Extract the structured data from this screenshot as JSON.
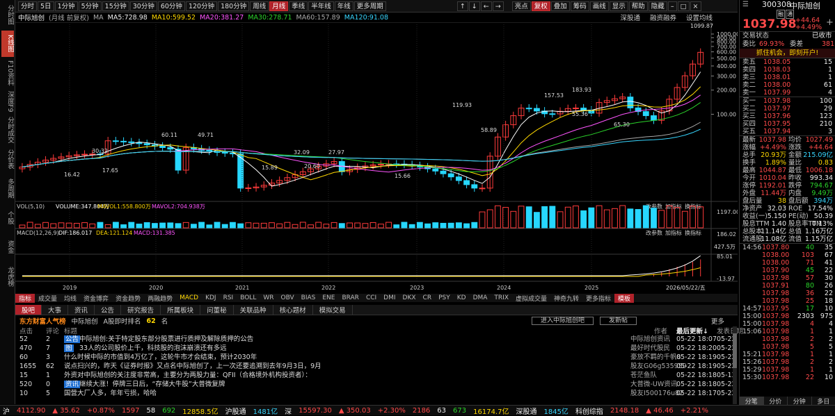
{
  "left_tabs": [
    "分时图",
    "K线图",
    "F10资料",
    "深度F9",
    "分时成交",
    "分价表",
    "多周期",
    "个股",
    "资金",
    "龙虎榜"
  ],
  "left_active": 1,
  "toolbar": {
    "periods": [
      "分时",
      "5日",
      "1分钟",
      "5分钟",
      "15分钟",
      "30分钟",
      "60分钟",
      "120分钟",
      "180分钟",
      "周线",
      "月线",
      "季线",
      "半年线",
      "年线",
      "更多周期"
    ],
    "active_period": "月线",
    "nav_arrows": [
      "↑",
      "↓",
      "←",
      "→"
    ],
    "right_items": [
      "亮点",
      "复权",
      "叠加",
      "筹码",
      "画线",
      "显示",
      "帮助",
      "隐藏"
    ],
    "active_right": "复权"
  },
  "info": {
    "stock_name": "中际旭创",
    "mode": "(月线 前复权)",
    "ma_label": "MA",
    "ma5": "MA5:728.98",
    "ma10": "MA10:599.52",
    "ma20": "MA20:381.27",
    "ma30": "MA30:278.71",
    "ma60": "MA60:157.89",
    "ma120": "MA120:91.08",
    "links": [
      "深股通",
      "融资融券",
      "设置均线"
    ]
  },
  "chart": {
    "y_ticks": [
      "1000.00",
      "900.00",
      "800.00",
      "700.00",
      "600.00",
      "500.00",
      "400.00",
      "300.00",
      "200.00",
      "100.00"
    ],
    "price_annotations": [
      "1099.87",
      "183.93",
      "157.53",
      "119.93",
      "60.11",
      "49.71",
      "32.09",
      "30.32",
      "27.97",
      "20.60",
      "17.65",
      "16.42",
      "15.89",
      "15.66",
      "58.89",
      "55.36",
      "65.30"
    ],
    "x_years": [
      "2019",
      "2020",
      "2021",
      "2022",
      "2023",
      "2024",
      "2025"
    ],
    "x_date": "2026/05/22/五",
    "vol_label": "VOL(5,10)",
    "vol_value": "VOLUME:347.804万",
    "vol_ma1": "MAVOL1:558.800万",
    "vol_ma2": "MAVOL2:704.938万",
    "vol_ticks": [
      "1197.00",
      "427.5万"
    ],
    "vol_links": [
      "改参数",
      "加指标",
      "换指标"
    ],
    "macd_label": "MACD(12,26,9)",
    "dif": "DIF:186.017",
    "dea": "DEA:121.124",
    "macd": "MACD:131.385",
    "macd_ticks": [
      "186.02",
      "85.01",
      "-13.97"
    ]
  },
  "indicator_tabs": [
    "指标",
    "成交量",
    "均线",
    "资金博弈",
    "资金趋势",
    "两融趋势",
    "MACD",
    "KDJ",
    "RSI",
    "BOLL",
    "WR",
    "OBV",
    "BIAS",
    "ENE",
    "BRAR",
    "CCI",
    "DMI",
    "DKX",
    "CR",
    "PSY",
    "KD",
    "DMA",
    "TRIX",
    "虚拟成交量",
    "神奇九转",
    "更多指标",
    "模板"
  ],
  "news_tabs": [
    "股吧",
    "大事",
    "资讯",
    "公告",
    "研究报告",
    "所属板块",
    "问董秘",
    "关联品种",
    "核心题材",
    "模拟交易"
  ],
  "news": {
    "brand": "东方财富人气榜",
    "stock": "中际旭创",
    "rank_label": "A股即时排名",
    "rank": "62",
    "rank_unit": "名",
    "enter_btn": "进入中际旭创吧",
    "post_btn": "发新帖",
    "more": "更多",
    "headers": [
      "点击",
      "评论",
      "标题",
      "作者",
      "最后更新",
      "发表日期"
    ],
    "rows": [
      {
        "clicks": "52",
        "comments": "2",
        "tag": "公告",
        "title": "中际旭创:关于特定股东部分股票进行质押及解除质押的公告",
        "author": "中际旭创资讯",
        "updated": "05-22 18:07",
        "date": "05-22"
      },
      {
        "clicks": "470",
        "comments": "7",
        "tag": "图",
        "title": "33人的公司股价上千，科技股的泡沫崩溃还有多远",
        "author": "最好时代股民",
        "updated": "05-22 18:20",
        "date": "05-22"
      },
      {
        "clicks": "60",
        "comments": "3",
        "tag": "",
        "title": "什么时候中际的市值到4万亿了，这轮牛市才会结束，预计2030年",
        "author": "豪放不羁的千帆8",
        "updated": "05-22 18:19",
        "date": "05-22"
      },
      {
        "clicks": "1655",
        "comments": "62",
        "tag": "",
        "title": "说点扫兴的，昨天《证券时报》又点名中际旭创了，上一次还要追溯到去年9月3日，9月",
        "author": "股友G06g535959",
        "updated": "05-22 18:19",
        "date": "05-22"
      },
      {
        "clicks": "15",
        "comments": "1",
        "tag": "",
        "title": "外资对中际旭创的关注度非常高，主要分为两股力量：QFII（合格境外机构投资者）：",
        "author": "苍茫鱼队",
        "updated": "05-22 18:18",
        "date": "05-13"
      },
      {
        "clicks": "520",
        "comments": "0",
        "tag": "资讯",
        "title": "继续大涨！停牌三日后，“存储大牛股”大普微复牌",
        "author": "大普微-UW资讯",
        "updated": "05-22 18:18",
        "date": "05-22"
      },
      {
        "clicks": "10",
        "comments": "5",
        "tag": "",
        "title": "国营大厂人多，年年亏损，哈哈",
        "author": "股友I500176u82",
        "updated": "05-22 18:17",
        "date": "05-22"
      }
    ]
  },
  "quote": {
    "code": "300308",
    "name": "中际旭创",
    "badges": [
      "融",
      "通"
    ],
    "price": "1037.98",
    "change": "+44.64",
    "pct": "+4.49%",
    "status_label": "交易状态",
    "status": "已收市",
    "weibi_label": "委比",
    "weibi": "69.93%",
    "weicha_label": "委差",
    "weicha": "381",
    "ad": "抓住机会，即刻开户!",
    "sells": [
      {
        "label": "卖五",
        "price": "1038.05",
        "vol": "15"
      },
      {
        "label": "卖四",
        "price": "1038.03",
        "vol": "1"
      },
      {
        "label": "卖三",
        "price": "1038.01",
        "vol": "1"
      },
      {
        "label": "卖二",
        "price": "1038.00",
        "vol": "61"
      },
      {
        "label": "卖一",
        "price": "1037.99",
        "vol": "4"
      }
    ],
    "buys": [
      {
        "label": "买一",
        "price": "1037.98",
        "vol": "100"
      },
      {
        "label": "买二",
        "price": "1037.97",
        "vol": "29"
      },
      {
        "label": "买三",
        "price": "1037.96",
        "vol": "123"
      },
      {
        "label": "买四",
        "price": "1037.95",
        "vol": "210"
      },
      {
        "label": "买五",
        "price": "1037.94",
        "vol": "3"
      }
    ],
    "stats": [
      {
        "l1": "最新",
        "v1": "1037.98",
        "c1": "red",
        "l2": "均价",
        "v2": "1027.49",
        "c2": "red"
      },
      {
        "l1": "涨幅",
        "v1": "+4.49%",
        "c1": "red",
        "l2": "涨跌",
        "v2": "+44.64",
        "c2": "red"
      },
      {
        "l1": "总手",
        "v1": "20.93万",
        "c1": "yel",
        "l2": "金额",
        "v2": "215.09亿",
        "c2": "cyan"
      },
      {
        "l1": "换手",
        "v1": "1.89%",
        "c1": "yel",
        "l2": "量比",
        "v2": "0.83",
        "c2": "yel"
      },
      {
        "l1": "最高",
        "v1": "1044.87",
        "c1": "red",
        "l2": "最低",
        "v2": "1006.18",
        "c2": "red"
      },
      {
        "l1": "今开",
        "v1": "1010.04",
        "c1": "red",
        "l2": "昨收",
        "v2": "993.34",
        "c2": "wht"
      },
      {
        "l1": "涨停",
        "v1": "1192.01",
        "c1": "red",
        "l2": "跌停",
        "v2": "794.67",
        "c2": "grn"
      },
      {
        "l1": "外盘",
        "v1": "11.44万",
        "c1": "red",
        "l2": "内盘",
        "v2": "9.49万",
        "c2": "grn"
      },
      {
        "l1": "盘后量",
        "v1": "38",
        "c1": "yel",
        "l2": "盘后额",
        "v2": "394万",
        "c2": "cyan"
      },
      {
        "l1": "净资产",
        "v1": "32.03",
        "c1": "wht",
        "l2": "ROE",
        "v2": "17.54%",
        "c2": "wht"
      },
      {
        "l1": "收益(一)",
        "v1": "5.150",
        "c1": "wht",
        "l2": "PE(动)",
        "v2": "50.39",
        "c2": "wht"
      },
      {
        "l1": "股息TTM",
        "v1": "1.40",
        "c1": "wht",
        "l2": "股息率TTM",
        "v2": "0.13%",
        "c2": "wht"
      },
      {
        "l1": "总股本",
        "v1": "11.14亿",
        "c1": "wht",
        "l2": "总值",
        "v2": "1.16万亿",
        "c2": "wht"
      },
      {
        "l1": "流通股",
        "v1": "11.08亿",
        "c1": "wht",
        "l2": "流值",
        "v2": "1.15万亿",
        "c2": "wht"
      }
    ],
    "ticks": [
      {
        "t": "14:56",
        "p": "1037.80",
        "v": "40",
        "n": "35",
        "c": "grn"
      },
      {
        "t": "",
        "p": "1038.00",
        "v": "103",
        "n": "67",
        "c": "red"
      },
      {
        "t": "",
        "p": "1038.00",
        "v": "71",
        "n": "41",
        "c": "red"
      },
      {
        "t": "",
        "p": "1037.90",
        "v": "45",
        "n": "22",
        "c": "grn"
      },
      {
        "t": "",
        "p": "1037.98",
        "v": "57",
        "n": "30",
        "c": "red"
      },
      {
        "t": "",
        "p": "1037.91",
        "v": "80",
        "n": "26",
        "c": "grn"
      },
      {
        "t": "",
        "p": "1037.98",
        "v": "36",
        "n": "22",
        "c": "red"
      },
      {
        "t": "",
        "p": "1037.98",
        "v": "25",
        "n": "18",
        "c": "red"
      },
      {
        "t": "14:57",
        "p": "1037.95",
        "v": "17",
        "n": "10",
        "c": "grn"
      },
      {
        "t": "15:00",
        "p": "1037.98",
        "v": "2303",
        "n": "975",
        "c": "wht"
      },
      {
        "t": "15:00",
        "p": "1037.98",
        "v": "4",
        "n": "4",
        "c": "red"
      },
      {
        "t": "15:06",
        "p": "1037.98",
        "v": "1",
        "n": "1",
        "c": "red"
      },
      {
        "t": "",
        "p": "1037.98",
        "v": "2",
        "n": "2",
        "c": "red"
      },
      {
        "t": "",
        "p": "1037.98",
        "v": "5",
        "n": "5",
        "c": "red"
      },
      {
        "t": "15:21",
        "p": "1037.98",
        "v": "1",
        "n": "1",
        "c": "red"
      },
      {
        "t": "15:26",
        "p": "1037.98",
        "v": "2",
        "n": "2",
        "c": "red"
      },
      {
        "t": "15:29",
        "p": "1037.98",
        "v": "1",
        "n": "1",
        "c": "red"
      },
      {
        "t": "15:30",
        "p": "1037.98",
        "v": "22",
        "n": "10",
        "c": "red"
      }
    ],
    "bottom_tabs": [
      "分笔",
      "分价",
      "分钟",
      "多日"
    ]
  },
  "status": {
    "items": [
      {
        "t": "沪",
        "c": "wht"
      },
      {
        "t": "4112.90",
        "c": "red"
      },
      {
        "t": "▲ 35.62",
        "c": "red"
      },
      {
        "t": "+0.87%",
        "c": "red"
      },
      {
        "t": "1597",
        "c": "red"
      },
      {
        "t": "58",
        "c": "wht"
      },
      {
        "t": "692",
        "c": "grn"
      },
      {
        "t": "12858.5亿",
        "c": "yel"
      },
      {
        "t": "沪股通",
        "c": "wht"
      },
      {
        "t": "1481亿",
        "c": "cyan"
      },
      {
        "t": "深",
        "c": "wht"
      },
      {
        "t": "15597.30",
        "c": "red"
      },
      {
        "t": "▲ 350.03",
        "c": "red"
      },
      {
        "t": "+2.30%",
        "c": "red"
      },
      {
        "t": "2186",
        "c": "red"
      },
      {
        "t": "63",
        "c": "wht"
      },
      {
        "t": "673",
        "c": "grn"
      },
      {
        "t": "16174.7亿",
        "c": "yel"
      },
      {
        "t": "深股通",
        "c": "wht"
      },
      {
        "t": "1845亿",
        "c": "cyan"
      },
      {
        "t": "科创综指",
        "c": "wht"
      },
      {
        "t": "2148.18",
        "c": "red"
      },
      {
        "t": "▲ 46.46",
        "c": "red"
      },
      {
        "t": "+2.21%",
        "c": "red"
      }
    ]
  }
}
